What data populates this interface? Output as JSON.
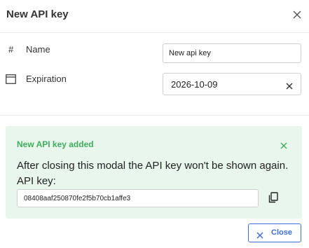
{
  "modal": {
    "title": "New API key",
    "close_icon": "close-icon"
  },
  "form": {
    "name": {
      "icon": "#",
      "label": "Name",
      "value": "New api key"
    },
    "expiration": {
      "icon": "calendar-icon",
      "label": "Expiration",
      "value": "2026-10-09",
      "clear_icon": "close-icon"
    }
  },
  "alert": {
    "title": "New API key added",
    "message": "After closing this modal the API key won't be shown again.",
    "key_label": "API key:",
    "key_value": "08408aaf250870fe2f5b70cb1affe3",
    "copy_icon": "copy-icon",
    "close_icon": "close-icon",
    "colors": {
      "background": "#e8f6ec",
      "title": "#3fae5c"
    }
  },
  "footer": {
    "close_label": "Close",
    "accent_color": "#3f6fd8"
  }
}
